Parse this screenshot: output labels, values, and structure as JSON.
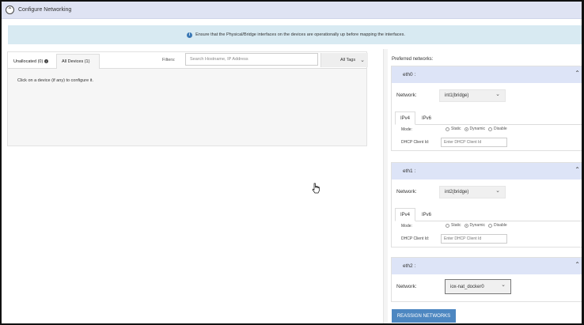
{
  "header": {
    "title": "Configure Networking"
  },
  "banner": {
    "text": "Ensure that the Physical/Bridge interfaces on the devices are operationally up before mapping the interfaces."
  },
  "left": {
    "tabs": [
      {
        "label": "Unallocated (0)"
      },
      {
        "label": "All Devices (1)"
      }
    ],
    "filters_label": "Filters:",
    "search_placeholder": "Search Hostname, IP Address",
    "tags_label": "All Tags",
    "hint": "Click on a device (if any) to configure it."
  },
  "right": {
    "preferred_label": "Preferred networks:",
    "network_label": "Network:",
    "mode_label": "Mode:",
    "dhcp_label": "DHCP Client Id:",
    "dhcp_placeholder": "Enter DHCP Client Id",
    "ipv4_label": "IPv4",
    "ipv6_label": "IPv6",
    "modes": [
      "Static",
      "Dynamic",
      "Disable"
    ],
    "selected_mode": "Dynamic",
    "interfaces": [
      {
        "name": "eth0 :",
        "network": "int1(bridge)"
      },
      {
        "name": "eth1 :",
        "network": "int2(bridge)"
      },
      {
        "name": "eth2 :",
        "network": "iox-nat_docker0"
      }
    ],
    "reassign_label": "REASSIGN NETWORKS"
  },
  "icons": [
    "collapse-icon",
    "info-icon",
    "chevron-down-icon",
    "chevron-up-icon",
    "hand-cursor-icon"
  ]
}
